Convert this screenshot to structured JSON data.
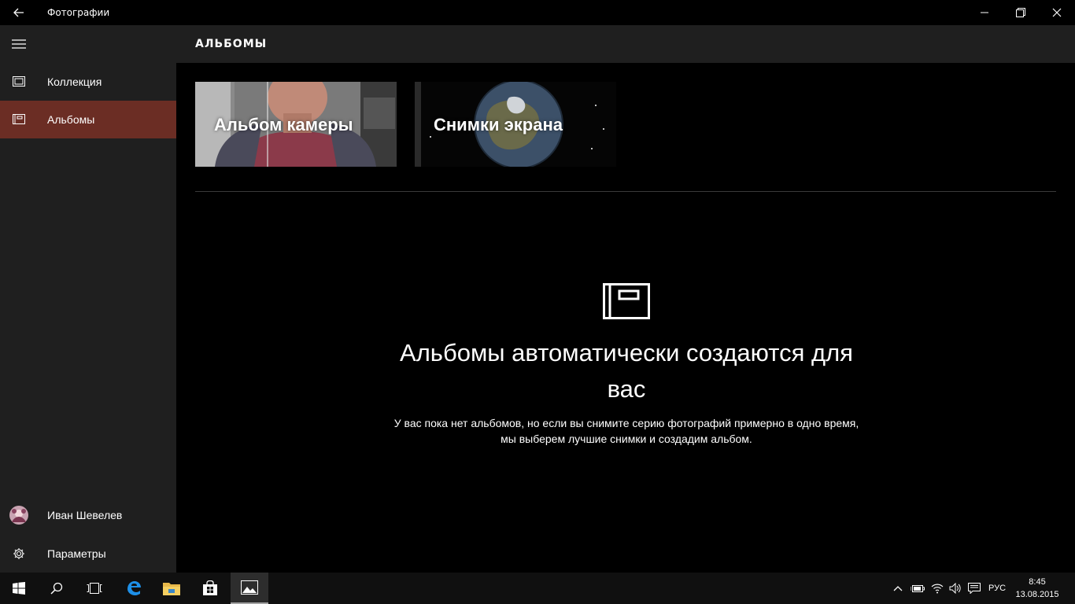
{
  "titlebar": {
    "app_title": "Фотографии",
    "icons": {
      "back": "back-arrow-icon",
      "minimize": "minimize-icon",
      "restore": "restore-icon",
      "close": "close-icon"
    }
  },
  "sidebar": {
    "items": [
      {
        "label": "Коллекция",
        "icon": "collection-icon",
        "active": false
      },
      {
        "label": "Альбомы",
        "icon": "album-icon",
        "active": true
      }
    ],
    "user": {
      "name": "Иван Шевелев",
      "icon": "avatar"
    },
    "settings": {
      "label": "Параметры",
      "icon": "gear-icon"
    }
  },
  "header": {
    "title": "АЛЬБОМЫ"
  },
  "albums": [
    {
      "label": "Альбом камеры"
    },
    {
      "label": "Снимки экрана"
    }
  ],
  "empty_state": {
    "title": "Альбомы автоматически создаются для вас",
    "description": "У вас пока нет альбомов, но если вы снимите серию фотографий примерно в одно время, мы выберем лучшие снимки и создадим альбом."
  },
  "taskbar": {
    "apps": [
      "start-icon",
      "search-icon",
      "task-view-icon",
      "edge-icon",
      "file-explorer-icon",
      "store-icon",
      "photos-icon"
    ],
    "language": "РУС",
    "time": "8:45",
    "date": "13.08.2015"
  },
  "colors": {
    "accent": "#6b2d24",
    "sidebar_bg": "#1f1f1f",
    "main_bg": "#000000",
    "taskbar_bg": "#101010"
  }
}
